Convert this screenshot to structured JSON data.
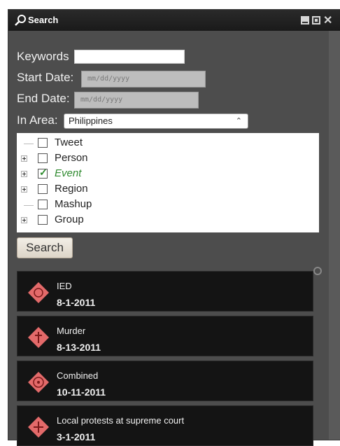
{
  "window": {
    "title": "Search",
    "close_glyph": "✕"
  },
  "form": {
    "keywords_label": "Keywords",
    "start_date_label": "Start Date:",
    "end_date_label": "End Date:",
    "area_label": "In Area:",
    "date_placeholder": "mm/dd/yyyy",
    "area_selected": "Philippines",
    "select_arrow": "⌃"
  },
  "tree": {
    "items": [
      {
        "label": "Tweet",
        "checked": false,
        "expandable": false
      },
      {
        "label": "Person",
        "checked": false,
        "expandable": true
      },
      {
        "label": "Event",
        "checked": true,
        "expandable": true
      },
      {
        "label": "Region",
        "checked": false,
        "expandable": true
      },
      {
        "label": "Mashup",
        "checked": false,
        "expandable": false
      },
      {
        "label": "Group",
        "checked": false,
        "expandable": true
      }
    ]
  },
  "search_button": "Search",
  "results": [
    {
      "title": "IED",
      "date": "8-1-2011",
      "icon": "ied-event-icon"
    },
    {
      "title": "Murder",
      "date": "8-13-2011",
      "icon": "murder-event-icon"
    },
    {
      "title": "Combined",
      "date": "10-11-2011",
      "icon": "combined-event-icon"
    },
    {
      "title": "Local protests at supreme court",
      "date": "3-1-2011",
      "icon": "protest-event-icon"
    }
  ],
  "colors": {
    "accent_icon": "#e36a6a",
    "checkbox_check": "#2b8a2b"
  }
}
